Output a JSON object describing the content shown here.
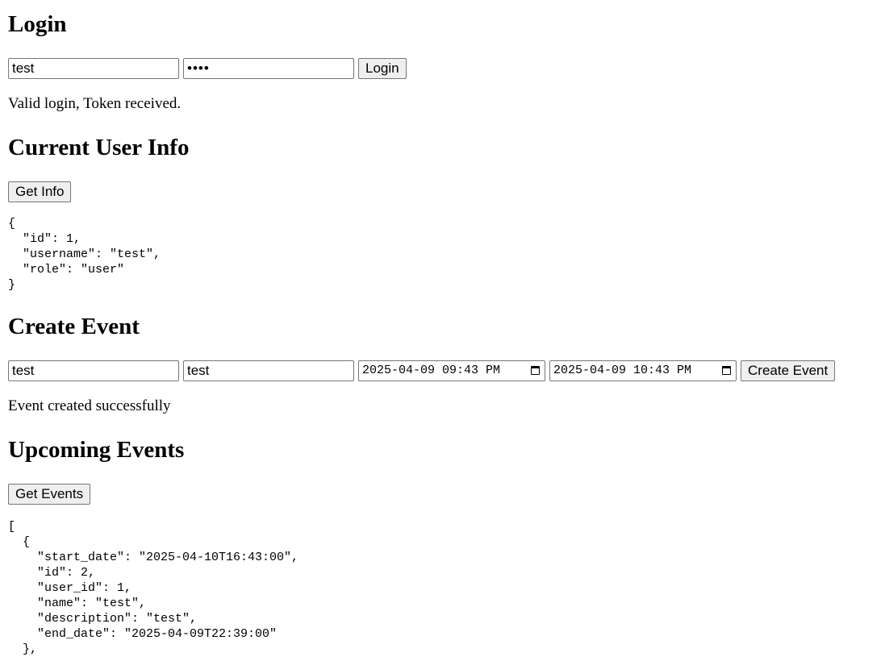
{
  "login": {
    "heading": "Login",
    "username_value": "test",
    "password_mask": "••••",
    "button_label": "Login",
    "message": "Valid login, Token received."
  },
  "user_info": {
    "heading": "Current User Info",
    "button_label": "Get Info",
    "json_output": "{\n  \"id\": 1,\n  \"username\": \"test\",\n  \"role\": \"user\"\n}"
  },
  "create_event": {
    "heading": "Create Event",
    "name_value": "test",
    "description_value": "test",
    "start_value": "2025-04-09 09:43 PM",
    "end_value": "2025-04-09 10:43 PM",
    "button_label": "Create Event",
    "message": "Event created successfully"
  },
  "upcoming_events": {
    "heading": "Upcoming Events",
    "button_label": "Get Events",
    "json_output": "[\n  {\n    \"start_date\": \"2025-04-10T16:43:00\",\n    \"id\": 2,\n    \"user_id\": 1,\n    \"name\": \"test\",\n    \"description\": \"test\",\n    \"end_date\": \"2025-04-09T22:39:00\"\n  },"
  },
  "icons": {
    "date_picker": "calendar-icon"
  },
  "colors": {
    "field_border": "#767676",
    "button_background": "#efefef",
    "page_background": "#ffffff"
  }
}
